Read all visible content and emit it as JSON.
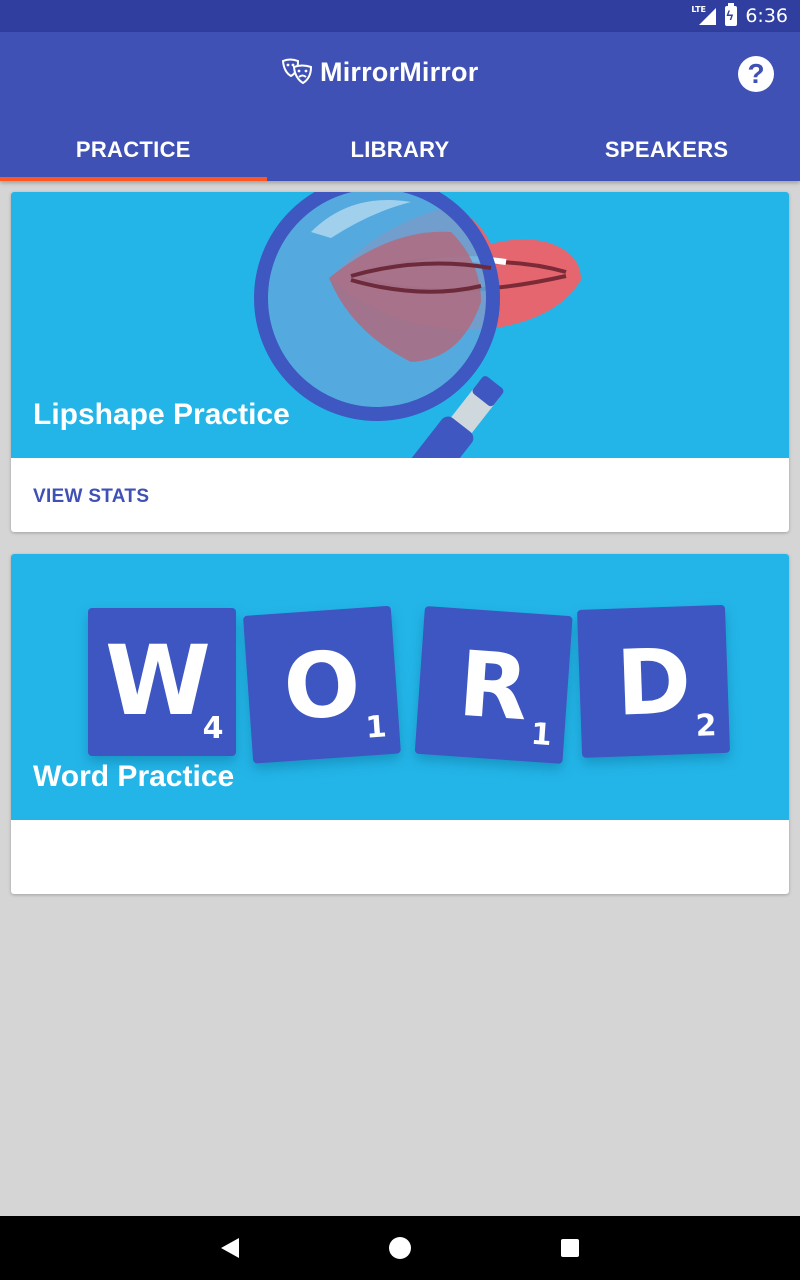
{
  "status_bar": {
    "network": "LTE",
    "time": "6:36"
  },
  "app_bar": {
    "title": "MirrorMirror",
    "help_icon": "help-circle-icon",
    "logo_icon": "theater-masks-icon"
  },
  "tabs": [
    {
      "label": "PRACTICE",
      "active": true
    },
    {
      "label": "LIBRARY",
      "active": false
    },
    {
      "label": "SPEAKERS",
      "active": false
    }
  ],
  "cards": [
    {
      "title": "Lipshape Practice",
      "action": "VIEW STATS",
      "illustration": "magnifier-lips"
    },
    {
      "title": "Word Practice",
      "action": "",
      "illustration": "word-tiles",
      "tiles": [
        {
          "letter": "W",
          "score": "4"
        },
        {
          "letter": "O",
          "score": "1"
        },
        {
          "letter": "R",
          "score": "1"
        },
        {
          "letter": "D",
          "score": "2"
        }
      ]
    }
  ],
  "nav": {
    "back_icon": "back-triangle-icon",
    "home_icon": "home-circle-icon",
    "recents_icon": "recents-square-icon"
  },
  "colors": {
    "primary": "#3f51b5",
    "primary_dark": "#303f9f",
    "accent": "#ff5722",
    "card_media": "#23b5e8",
    "tile": "#3e57c1"
  }
}
